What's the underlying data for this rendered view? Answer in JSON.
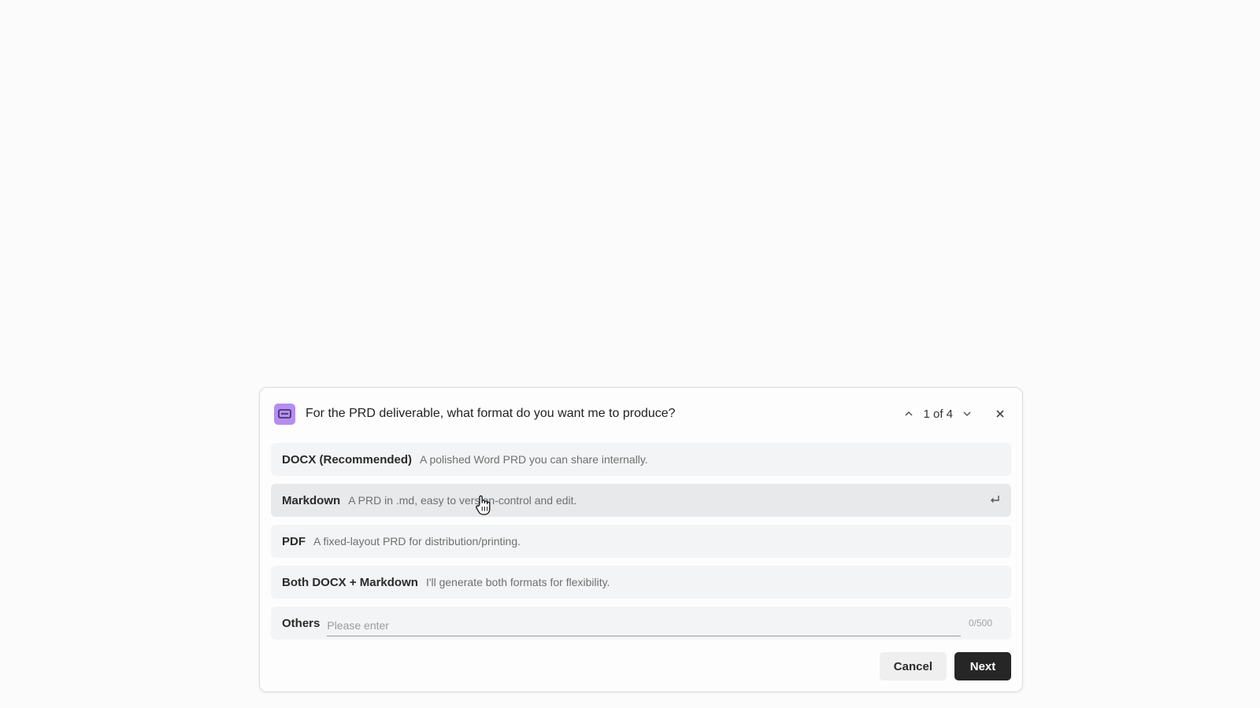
{
  "dialog": {
    "question": "For the PRD deliverable, what format do you want me to produce?",
    "pager": {
      "text": "1 of 4",
      "prev_icon": "chevron-up-icon",
      "next_icon": "chevron-down-icon"
    },
    "close_icon": "close-icon",
    "app_icon": "chat-bubble-icon",
    "accent_color": "#b48ef0"
  },
  "options": [
    {
      "label": "DOCX (Recommended)",
      "description": "A polished Word PRD you can share internally."
    },
    {
      "label": "Markdown",
      "description": "A PRD in .md, easy to version-control and edit.",
      "hovered": true,
      "icon": "enter-icon"
    },
    {
      "label": "PDF",
      "description": "A fixed-layout PRD for distribution/printing."
    },
    {
      "label": "Both DOCX + Markdown",
      "description": "I'll generate both formats for flexibility."
    }
  ],
  "others": {
    "label": "Others",
    "placeholder": "Please enter",
    "value": "",
    "counter": "0/500"
  },
  "buttons": {
    "cancel": "Cancel",
    "next": "Next"
  },
  "cursor_icon": "hand-pointer-icon"
}
